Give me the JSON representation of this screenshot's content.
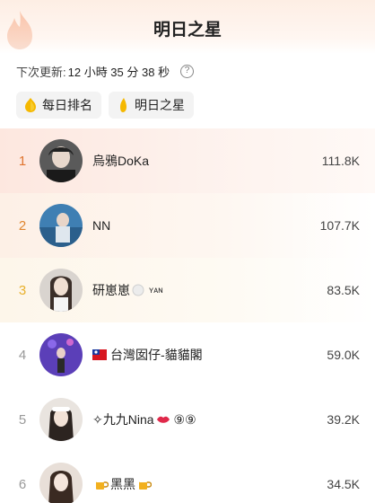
{
  "header": {
    "title": "明日之星"
  },
  "countdown": {
    "label": "下次更新:",
    "value": "12 小時 35 分 38 秒",
    "help_glyph": "?"
  },
  "tabs": [
    {
      "label": "每日排名",
      "icon": "coin-icon"
    },
    {
      "label": "明日之星",
      "icon": "coin-side-icon"
    }
  ],
  "rows": [
    {
      "rank": "1",
      "name": "烏鴉DoKa",
      "score": "111.8K"
    },
    {
      "rank": "2",
      "name": "NN",
      "score": "107.7K"
    },
    {
      "rank": "3",
      "name": "研崽崽",
      "name_suffix": "ʏᴀɴ",
      "score": "83.5K"
    },
    {
      "rank": "4",
      "name": "台灣囡仔-貓貓閣",
      "score": "59.0K"
    },
    {
      "rank": "5",
      "name": "✧九九Nina",
      "name_suffix": "⑨⑨",
      "score": "39.2K"
    },
    {
      "rank": "6",
      "name": "黑黑",
      "score": "34.5K"
    }
  ],
  "colors": {
    "rank1": "#e0742f",
    "rank2": "#e0862f",
    "rank3": "#e8b02c",
    "rank_default": "#999999"
  }
}
